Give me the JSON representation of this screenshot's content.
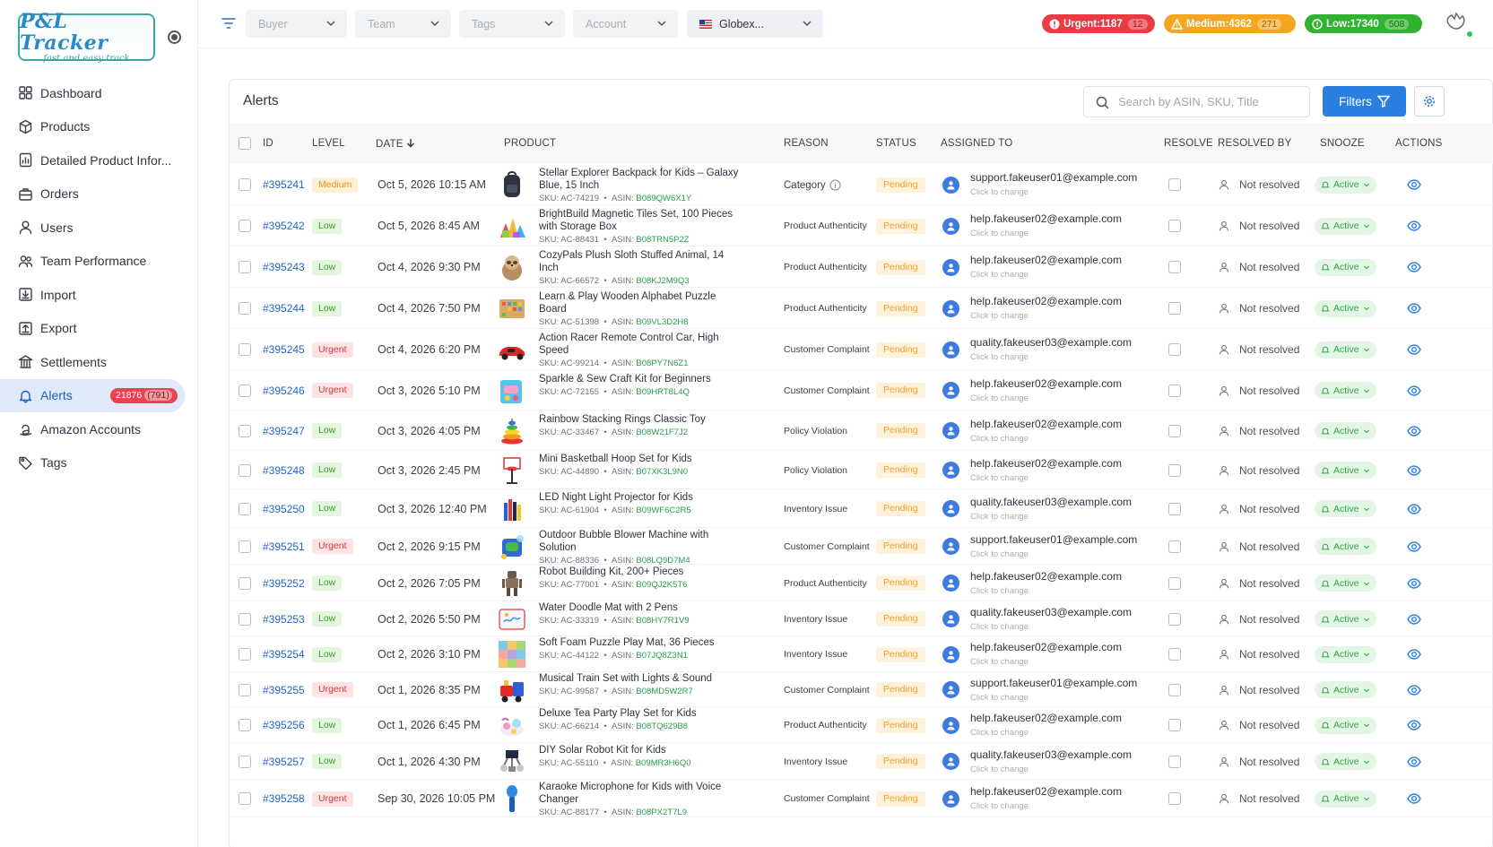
{
  "brand": {
    "logo_main": "P&L Tracker",
    "logo_sub": "fast and easy track"
  },
  "sidebar": {
    "items": [
      {
        "label": "Dashboard",
        "icon": "dashboard-icon"
      },
      {
        "label": "Products",
        "icon": "box-icon"
      },
      {
        "label": "Detailed Product Infor...",
        "icon": "chart-doc-icon"
      },
      {
        "label": "Orders",
        "icon": "briefcase-icon"
      },
      {
        "label": "Users",
        "icon": "user-icon"
      },
      {
        "label": "Team Performance",
        "icon": "team-icon"
      },
      {
        "label": "Import",
        "icon": "import-icon"
      },
      {
        "label": "Export",
        "icon": "export-icon"
      },
      {
        "label": "Settlements",
        "icon": "bank-icon"
      },
      {
        "label": "Alerts",
        "icon": "bell-icon",
        "badge": "21876",
        "badge_sub": "791",
        "active": true
      },
      {
        "label": "Amazon Accounts",
        "icon": "amazon-icon"
      },
      {
        "label": "Tags",
        "icon": "tag-icon"
      }
    ]
  },
  "topbar": {
    "buyer": "Buyer",
    "team": "Team",
    "tags": "Tags",
    "account": "Account",
    "account2": "Globex...",
    "urgent": "Urgent:1187",
    "urgent_sub": "12",
    "medium": "Medium:4362",
    "medium_sub": "271",
    "low": "Low:17340",
    "low_sub": "508"
  },
  "alerts": {
    "title": "Alerts",
    "search_placeholder": "Search by ASIN, SKU, Title",
    "filters_label": "Filters",
    "columns": {
      "id": "ID",
      "level": "LEVEL",
      "date": "DATE",
      "product": "PRODUCT",
      "reason": "REASON",
      "status": "STATUS",
      "assigned": "ASSIGNED TO",
      "resolve": "RESOLVE",
      "resolved_by": "RESOLVED BY",
      "snooze": "SNOOZE",
      "actions": "ACTIONS"
    },
    "rows": [
      {
        "id": "#395241",
        "level": "Medium",
        "date": "Oct 5, 2026 10:15 AM",
        "title": "Stellar Explorer Backpack for Kids – Galaxy Blue, 15 Inch",
        "sku": "SKU: AC-74219",
        "asin": "B089QW6X1Y",
        "reason": "Category",
        "status": "Pending",
        "email": "support.fakeuser01@example.com",
        "click": "Click to change",
        "resolved_by": "Not resolved",
        "snooze": "Active",
        "thumb": "backpack"
      },
      {
        "id": "#395242",
        "level": "Low",
        "date": "Oct 5, 2026 8:45 AM",
        "title": "BrightBuild Magnetic Tiles Set, 100 Pieces with Storage Box",
        "sku": "SKU: AC-88431",
        "asin": "B08TRN5P2Z",
        "reason": "Product Authenticity",
        "status": "Pending",
        "email": "help.fakeuser02@example.com",
        "click": "Click to change",
        "resolved_by": "Not resolved",
        "snooze": "Active",
        "thumb": "tiles"
      },
      {
        "id": "#395243",
        "level": "Low",
        "date": "Oct 4, 2026 9:30 PM",
        "title": "CozyPals Plush Sloth Stuffed Animal, 14 Inch",
        "sku": "SKU: AC-66572",
        "asin": "B08KJ2M9Q3",
        "reason": "Product Authenticity",
        "status": "Pending",
        "email": "help.fakeuser02@example.com",
        "click": "Click to change",
        "resolved_by": "Not resolved",
        "snooze": "Active",
        "thumb": "sloth"
      },
      {
        "id": "#395244",
        "level": "Low",
        "date": "Oct 4, 2026 7:50 PM",
        "title": "Learn & Play Wooden Alphabet Puzzle Board",
        "sku": "SKU: AC-51398",
        "asin": "B09VL3D2H8",
        "reason": "Product Authenticity",
        "status": "Pending",
        "email": "help.fakeuser02@example.com",
        "click": "Click to change",
        "resolved_by": "Not resolved",
        "snooze": "Active",
        "thumb": "puzzle"
      },
      {
        "id": "#395245",
        "level": "Urgent",
        "date": "Oct 4, 2026 6:20 PM",
        "title": "Action Racer Remote Control Car, High Speed",
        "sku": "SKU: AC-99214",
        "asin": "B08PY7N6Z1",
        "reason": "Customer Complaint",
        "status": "Pending",
        "email": "quality.fakeuser03@example.com",
        "click": "Click to change",
        "resolved_by": "Not resolved",
        "snooze": "Active",
        "thumb": "car"
      },
      {
        "id": "#395246",
        "level": "Urgent",
        "date": "Oct 3, 2026 5:10 PM",
        "title": "Sparkle & Sew Craft Kit for Beginners",
        "sku": "SKU: AC-72155",
        "asin": "B09HRT8L4Q",
        "reason": "Customer Complaint",
        "status": "Pending",
        "email": "help.fakeuser02@example.com",
        "click": "Click to change",
        "resolved_by": "Not resolved",
        "snooze": "Active",
        "thumb": "craft"
      },
      {
        "id": "#395247",
        "level": "Low",
        "date": "Oct 3, 2026 4:05 PM",
        "title": "Rainbow Stacking Rings Classic Toy",
        "sku": "SKU: AC-33467",
        "asin": "B08W21F7J2",
        "reason": "Policy Violation",
        "status": "Pending",
        "email": "help.fakeuser02@example.com",
        "click": "Click to change",
        "resolved_by": "Not resolved",
        "snooze": "Active",
        "thumb": "rings"
      },
      {
        "id": "#395248",
        "level": "Low",
        "date": "Oct 3, 2026 2:45 PM",
        "title": "Mini Basketball Hoop Set for Kids",
        "sku": "SKU: AC-44890",
        "asin": "B07XK3L9N0",
        "reason": "Policy Violation",
        "status": "Pending",
        "email": "help.fakeuser02@example.com",
        "click": "Click to change",
        "resolved_by": "Not resolved",
        "snooze": "Active",
        "thumb": "hoop"
      },
      {
        "id": "#395250",
        "level": "Low",
        "date": "Oct 3, 2026 12:40 PM",
        "title": "LED Night Light Projector for Kids",
        "sku": "SKU: AC-61904",
        "asin": "B09WF6C2R5",
        "reason": "Inventory Issue",
        "status": "Pending",
        "email": "quality.fakeuser03@example.com",
        "click": "Click to change",
        "resolved_by": "Not resolved",
        "snooze": "Active",
        "thumb": "crayons"
      },
      {
        "id": "#395251",
        "level": "Urgent",
        "date": "Oct 2, 2026 9:15 PM",
        "title": "Outdoor Bubble Blower Machine with Solution",
        "sku": "SKU: AC-88336",
        "asin": "B08LQ9D7M4",
        "reason": "Customer Complaint",
        "status": "Pending",
        "email": "support.fakeuser01@example.com",
        "click": "Click to change",
        "resolved_by": "Not resolved",
        "snooze": "Active",
        "thumb": "bubble"
      },
      {
        "id": "#395252",
        "level": "Low",
        "date": "Oct 2, 2026 7:05 PM",
        "title": "Robot Building Kit, 200+ Pieces",
        "sku": "SKU: AC-77001",
        "asin": "B09QJ2K5T6",
        "reason": "Product Authenticity",
        "status": "Pending",
        "email": "help.fakeuser02@example.com",
        "click": "Click to change",
        "resolved_by": "Not resolved",
        "snooze": "Active",
        "thumb": "robot"
      },
      {
        "id": "#395253",
        "level": "Low",
        "date": "Oct 2, 2026 5:50 PM",
        "title": "Water Doodle Mat with 2 Pens",
        "sku": "SKU: AC-33319",
        "asin": "B08HY7R1V9",
        "reason": "Inventory Issue",
        "status": "Pending",
        "email": "quality.fakeuser03@example.com",
        "click": "Click to change",
        "resolved_by": "Not resolved",
        "snooze": "Active",
        "thumb": "doodle"
      },
      {
        "id": "#395254",
        "level": "Low",
        "date": "Oct 2, 2026 3:10 PM",
        "title": "Soft Foam Puzzle Play Mat, 36 Pieces",
        "sku": "SKU: AC-44122",
        "asin": "B07JQ8Z3N1",
        "reason": "Inventory Issue",
        "status": "Pending",
        "email": "help.fakeuser02@example.com",
        "click": "Click to change",
        "resolved_by": "Not resolved",
        "snooze": "Active",
        "thumb": "foam"
      },
      {
        "id": "#395255",
        "level": "Urgent",
        "date": "Oct 1, 2026 8:35 PM",
        "title": "Musical Train Set with Lights & Sound",
        "sku": "SKU: AC-99587",
        "asin": "B08MD5W2R7",
        "reason": "Customer Complaint",
        "status": "Pending",
        "email": "support.fakeuser01@example.com",
        "click": "Click to change",
        "resolved_by": "Not resolved",
        "snooze": "Active",
        "thumb": "train"
      },
      {
        "id": "#395256",
        "level": "Low",
        "date": "Oct 1, 2026 6:45 PM",
        "title": "Deluxe Tea Party Play Set for Kids",
        "sku": "SKU: AC-66214",
        "asin": "B08TQ629B8",
        "reason": "Product Authenticity",
        "status": "Pending",
        "email": "help.fakeuser02@example.com",
        "click": "Click to change",
        "resolved_by": "Not resolved",
        "snooze": "Active",
        "thumb": "tea"
      },
      {
        "id": "#395257",
        "level": "Low",
        "date": "Oct 1, 2026 4:30 PM",
        "title": "DIY Solar Robot Kit for Kids",
        "sku": "SKU: AC-55110",
        "asin": "B09MR3H6Q0",
        "reason": "Inventory Issue",
        "status": "Pending",
        "email": "quality.fakeuser03@example.com",
        "click": "Click to change",
        "resolved_by": "Not resolved",
        "snooze": "Active",
        "thumb": "solar"
      },
      {
        "id": "#395258",
        "level": "Urgent",
        "date": "Sep 30, 2026 10:05 PM",
        "title": "Karaoke Microphone for Kids with Voice Changer",
        "sku": "SKU: AC-88177",
        "asin": "B08PX2T7L9",
        "reason": "Customer Complaint",
        "status": "Pending",
        "email": "help.fakeuser02@example.com",
        "click": "Click to change",
        "resolved_by": "Not resolved",
        "snooze": "Active",
        "thumb": "mic"
      }
    ]
  }
}
